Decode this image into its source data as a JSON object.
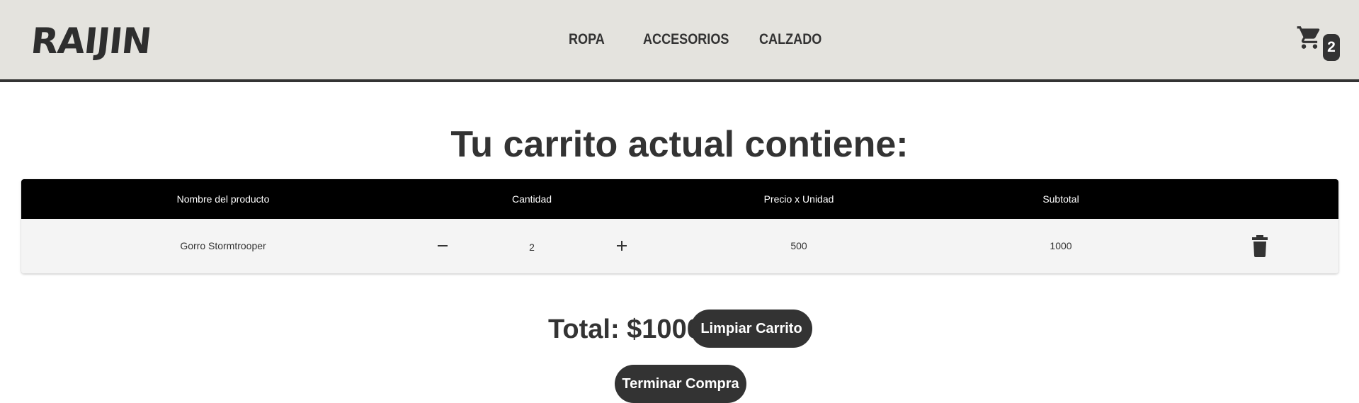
{
  "brand": {
    "logo_text": "RAIJIN"
  },
  "nav": {
    "links": [
      {
        "label": "ROPA"
      },
      {
        "label": "ACCESORIOS"
      },
      {
        "label": "CALZADO"
      }
    ],
    "cart": {
      "icon": "shopping-cart-icon",
      "count": "2"
    }
  },
  "cart": {
    "title": "Tu carrito actual contiene:",
    "columns": [
      "Nombre del producto",
      "Cantidad",
      "Precio x Unidad",
      "Subtotal"
    ],
    "items": [
      {
        "name": "Gorro Stormtrooper",
        "quantity": "2",
        "unit_price": "500",
        "subtotal": "1000",
        "decrease_icon": "minus-icon",
        "increase_icon": "plus-icon",
        "delete_icon": "trash-icon"
      }
    ],
    "total_label": "Total: $1000",
    "clear_button": "Limpiar Carrito",
    "finish_button": "Terminar Compra"
  },
  "colors": {
    "navbar_bg": "#e4e3de",
    "text_dark": "#333333",
    "table_header_bg": "#000000",
    "row_bg": "#f4f4f4",
    "button_bg": "#333333"
  }
}
